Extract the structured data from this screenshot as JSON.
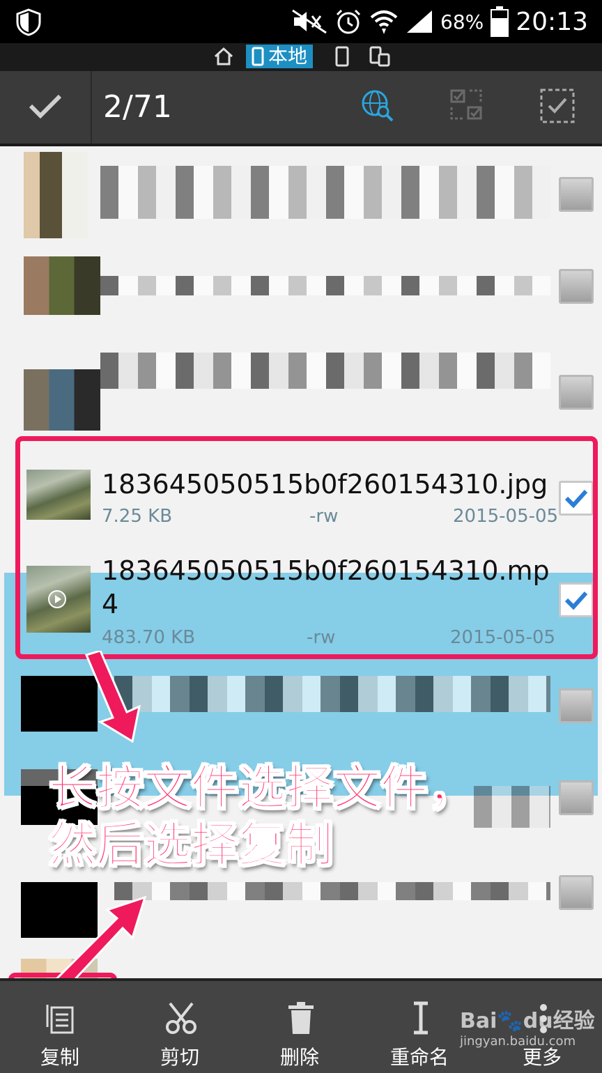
{
  "status_bar": {
    "battery": "68%",
    "time": "20:13"
  },
  "location_bar": {
    "local_label": "本地"
  },
  "action_bar": {
    "selection_count": "2/71"
  },
  "files": [
    {
      "name": "183645050515b0f260154310.jpg",
      "size": "7.25 KB",
      "perm": "-rw",
      "date": "2015-05-05",
      "checked": true
    },
    {
      "name_line1": "183645050515b0f260154310.mp",
      "name_line2": "4",
      "size": "483.70 KB",
      "perm": "-rw",
      "date": "2015-05-05",
      "checked": true
    }
  ],
  "annotation": {
    "line1": "长按文件选择文件，",
    "line2": "然后选择复制"
  },
  "bottom_bar": {
    "copy": "复制",
    "cut": "剪切",
    "delete": "删除",
    "rename": "重命名",
    "more": "更多"
  },
  "watermark": {
    "brand": "Bai🐾du经验",
    "url": "jingyan.baidu.com"
  },
  "colors": {
    "accent": "#1d8fc2",
    "selection": "#86cde8",
    "annotation": "#ee1a5c"
  }
}
